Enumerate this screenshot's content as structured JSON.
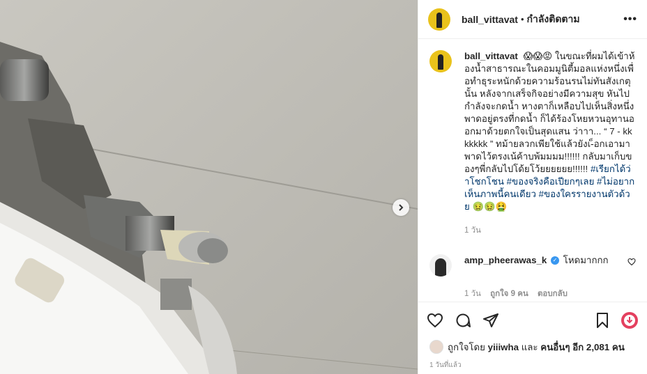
{
  "post": {
    "username": "ball_vittavat",
    "header_separator": "•",
    "follow_label": "กำลังติดตาม",
    "more_label": "•••"
  },
  "caption": {
    "username": "ball_vittavat",
    "text": "😱😱😡 ในขณะที่ผมได้เข้าห้องน้ำสาธารณะในคอมมูนิตี้มอลแห่งหนึ่งเพื่อทำธุระหนักด้วยความร้อนรนไม่ทันสังเกตุนั้น หลังจากเสร็จกิจอย่างมีความสุข หันไปกำลังจะกดน้ำ หางตาก็เหลือบไปเห็นสิ่งหนึ่งพาดอยู่ตรงที่กดน้ำ ก็ได้ร้องโหยหวนอุทานออกมาด้วยตกใจเป็นสุดแสน ว่าาา... “ 7 - kkkkkkk ” ทม้ายลวกเพียใช้แล้วยังเ-็อกเอามาพาดไว้ตรงเน้ค้าบพ้มมมม!!!!!! กลับมาเก็บของๆพี่กลับไปโด้ยโว้ยยยยยย!!!!!!",
    "hashtags": "#เรียกได้ว่าโชกโชน #ของจริงคือเปียกๆเลย #ไม่อยากเห็นภาพนี้คนเดียว #ของใครรายงานตัวด้วย",
    "end_emoji": "🤢🤢🤮",
    "time": "1 วัน"
  },
  "comment": {
    "username": "amp_pheerawas_k",
    "verified_mark": "✓",
    "text": "โหดมากกก",
    "time": "1 วัน",
    "likes": "ถูกใจ 9 คน",
    "reply_label": "ตอบกลับ"
  },
  "likes": {
    "prefix": "ถูกใจโดย",
    "first_user": "yiiiwha",
    "and": "และ",
    "others": "คนอื่นๆ อีก 2,081 คน"
  },
  "posted_ago": "1 วันที่แล้ว",
  "icons": {
    "like": "heart-icon",
    "comment": "comment-icon",
    "share": "share-icon",
    "save": "bookmark-icon",
    "next": "chevron-right-icon",
    "comment_like": "heart-icon"
  },
  "colors": {
    "link": "#00376b",
    "muted": "#8e8e8e",
    "verified": "#3897f0"
  }
}
